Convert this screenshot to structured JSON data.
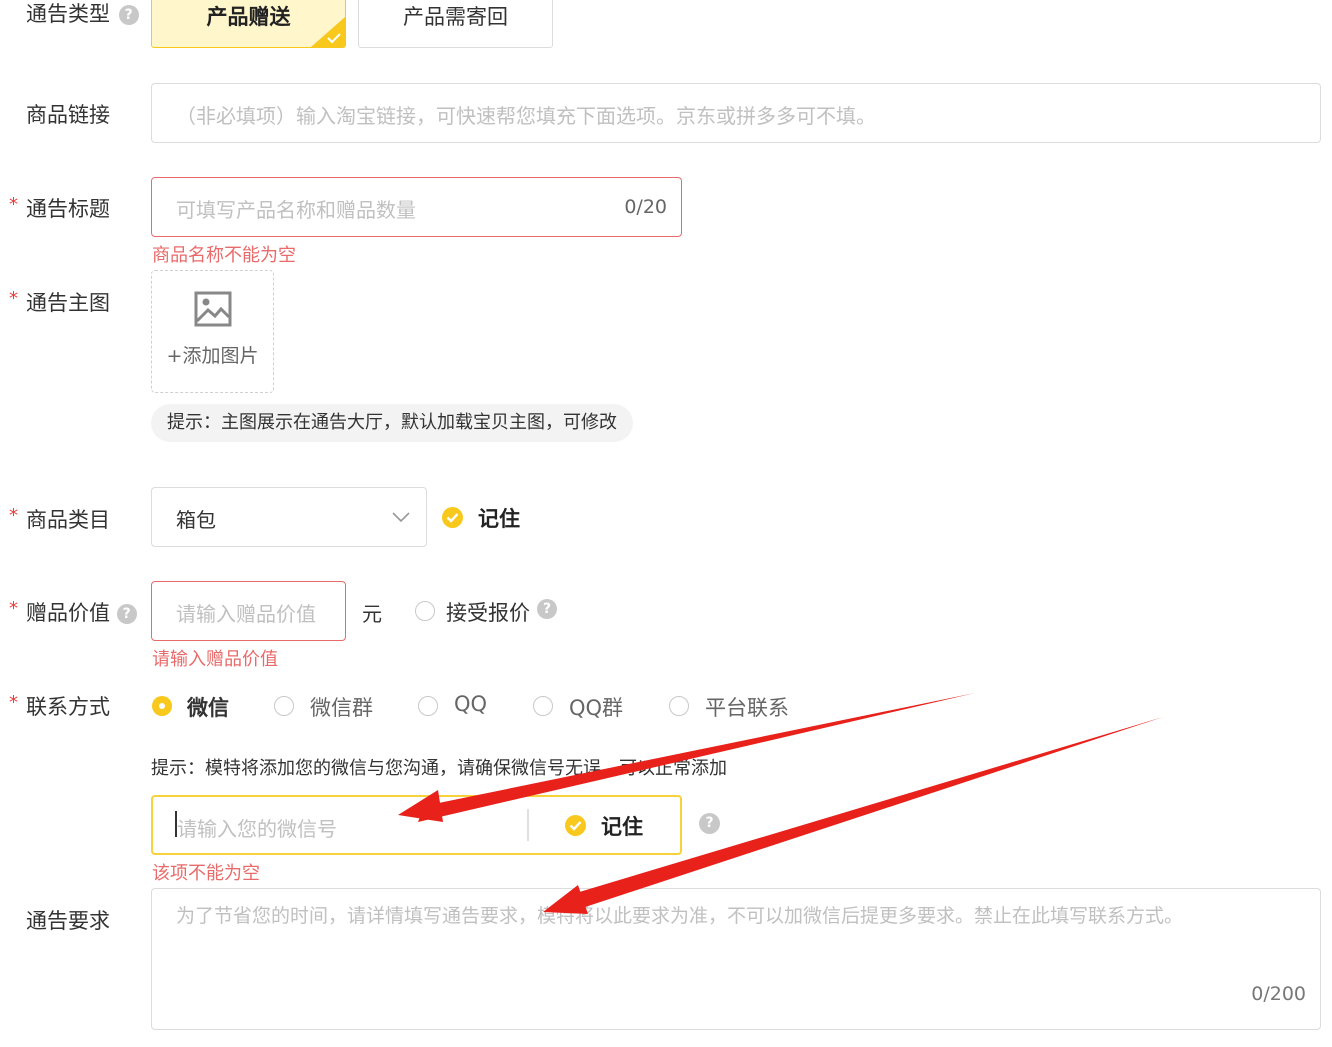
{
  "type_row": {
    "label": "通告类型",
    "options": [
      {
        "label": "产品赠送",
        "selected": true
      },
      {
        "label": "产品需寄回",
        "selected": false
      }
    ]
  },
  "product_link": {
    "label": "商品链接",
    "placeholder": "（非必填项）输入淘宝链接，可快速帮您填充下面选项。京东或拼多多可不填。"
  },
  "title_row": {
    "label": "通告标题",
    "placeholder": "可填写产品名称和赠品数量",
    "counter": "0/20",
    "error": "商品名称不能为空"
  },
  "main_image": {
    "label": "通告主图",
    "upload_label": "+添加图片",
    "tip": "提示：主图展示在通告大厅，默认加载宝贝主图，可修改"
  },
  "category": {
    "label": "商品类目",
    "value": "箱包",
    "remember_label": "记住"
  },
  "gift_value": {
    "label": "赠品价值",
    "placeholder": "请输入赠品价值",
    "unit": "元",
    "accept_quote_label": "接受报价",
    "error": "请输入赠品价值"
  },
  "contact": {
    "label": "联系方式",
    "options": [
      {
        "label": "微信",
        "selected": true
      },
      {
        "label": "微信群",
        "selected": false
      },
      {
        "label": "QQ",
        "selected": false
      },
      {
        "label": "QQ群",
        "selected": false
      },
      {
        "label": "平台联系",
        "selected": false
      }
    ],
    "tip": "提示：模特将添加您的微信与您沟通，请确保微信号无误，可以正常添加",
    "wechat_placeholder": "请输入您的微信号",
    "remember_label": "记住",
    "error": "该项不能为空"
  },
  "requirements": {
    "label": "通告要求",
    "placeholder": "为了节省您的时间，请详情填写通告要求，模特将以此要求为准，不可以加微信后提更多要求。禁止在此填写联系方式。",
    "counter": "0/200"
  },
  "colors": {
    "accent": "#f8c81c",
    "accent_bg": "#fff6cc",
    "error": "#e96a6a",
    "annotation_arrow": "#e8211b"
  }
}
